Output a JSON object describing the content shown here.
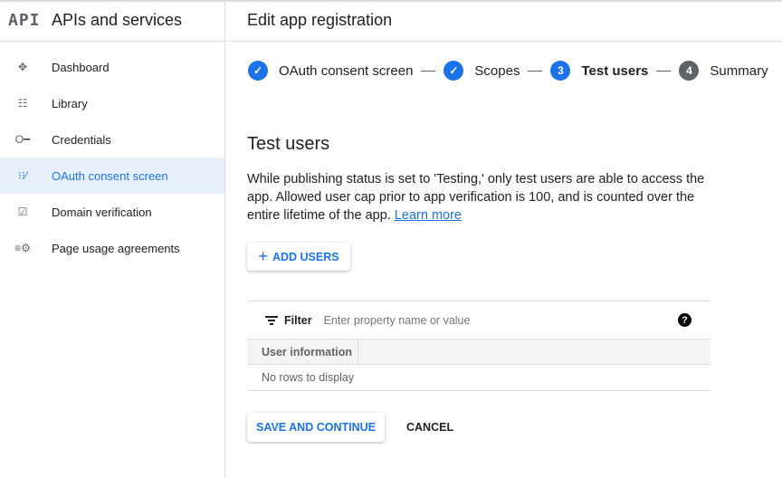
{
  "sidebar": {
    "logo": "API",
    "title": "APIs and services",
    "items": [
      {
        "label": "Dashboard",
        "icon": "dashboard-icon"
      },
      {
        "label": "Library",
        "icon": "library-icon"
      },
      {
        "label": "Credentials",
        "icon": "key-icon"
      },
      {
        "label": "OAuth consent screen",
        "icon": "oauth-icon",
        "active": true
      },
      {
        "label": "Domain verification",
        "icon": "checkbox-icon"
      },
      {
        "label": "Page usage agreements",
        "icon": "settings-list-icon"
      }
    ]
  },
  "header": {
    "title": "Edit app registration"
  },
  "stepper": {
    "steps": [
      {
        "label": "OAuth consent screen",
        "state": "done"
      },
      {
        "label": "Scopes",
        "state": "done"
      },
      {
        "number": "3",
        "label": "Test users",
        "state": "active"
      },
      {
        "number": "4",
        "label": "Summary",
        "state": "pending"
      }
    ]
  },
  "main": {
    "title": "Test users",
    "description": "While publishing status is set to 'Testing,' only test users are able to access the app. Allowed user cap prior to app verification is 100, and is counted over the entire lifetime of the app.",
    "learn_more": "Learn more",
    "add_users": "ADD USERS",
    "filter": {
      "label": "Filter",
      "placeholder": "Enter property name or value"
    },
    "table": {
      "columns": [
        "User information"
      ],
      "empty": "No rows to display"
    },
    "save": "SAVE AND CONTINUE",
    "cancel": "CANCEL"
  },
  "colors": {
    "accent": "#1a73e8",
    "active_bg": "#e8f0fe"
  }
}
